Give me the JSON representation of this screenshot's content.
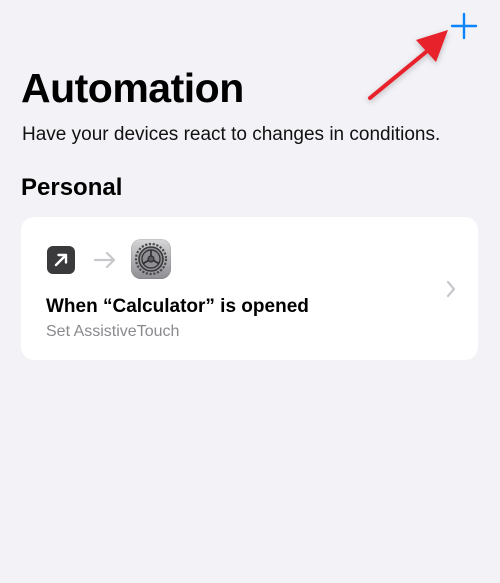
{
  "header": {
    "add_button_label": "+",
    "title": "Automation",
    "subtitle": "Have your devices react to changes in conditions."
  },
  "sections": [
    {
      "title": "Personal",
      "items": [
        {
          "title": "When “Calculator” is opened",
          "subtitle": "Set AssistiveTouch",
          "trigger_icon": "open-app-icon",
          "action_icon": "settings-app-icon"
        }
      ]
    }
  ],
  "colors": {
    "background": "#f2f2f7",
    "card": "#ffffff",
    "accent": "#0a84ff",
    "annotation": "#e8202a",
    "secondary_text": "#8a8a8e"
  }
}
